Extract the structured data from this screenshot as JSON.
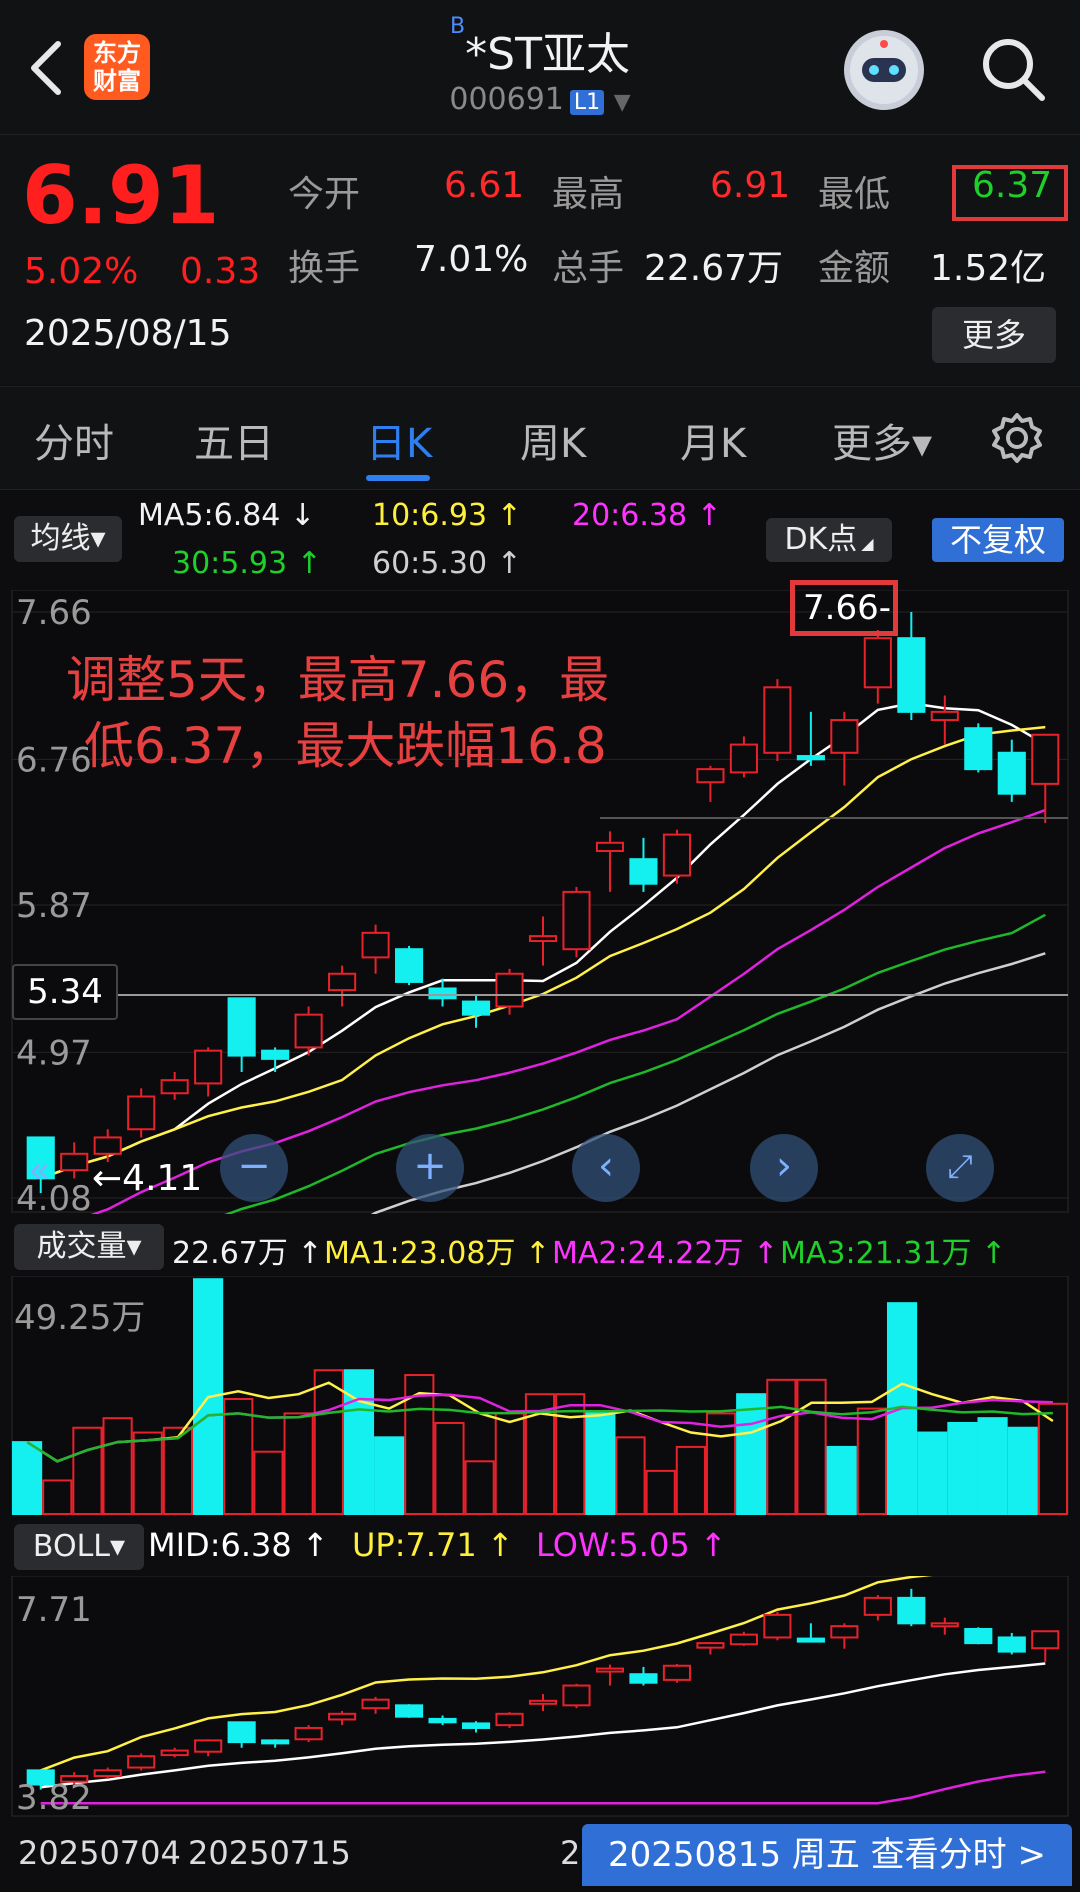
{
  "header": {
    "logo_text": "东方\n财富",
    "title_prefix": "B",
    "title": "*ST亚太",
    "code": "000691",
    "level_badge": "L1"
  },
  "quote": {
    "price": "6.91",
    "change_pct": "5.02%",
    "change_amt": "0.33",
    "date": "2025/08/15",
    "fields": [
      {
        "label": "今开",
        "value": "6.61",
        "color": "red"
      },
      {
        "label": "最高",
        "value": "6.91",
        "color": "red"
      },
      {
        "label": "最低",
        "value": "6.37",
        "color": "grn"
      },
      {
        "label": "换手",
        "value": "7.01%",
        "color": "wht"
      },
      {
        "label": "总手",
        "value": "22.67万",
        "color": "wht"
      },
      {
        "label": "金额",
        "value": "1.52亿",
        "color": "wht"
      }
    ],
    "more_label": "更多"
  },
  "tabs": [
    {
      "label": "分时"
    },
    {
      "label": "五日"
    },
    {
      "label": "日K",
      "active": true
    },
    {
      "label": "周K"
    },
    {
      "label": "月K"
    },
    {
      "label": "更多▾"
    }
  ],
  "ma_bar": {
    "selector": "均线▾",
    "ma5": "MA5:6.84",
    "ma10": "10:6.93",
    "ma20": "20:6.38",
    "ma30": "30:5.93",
    "ma60": "60:5.30",
    "dk_label": "DK点",
    "fq_label": "不复权"
  },
  "kline": {
    "y_labels": [
      "7.66",
      "6.76",
      "5.87",
      "4.97",
      "4.08"
    ],
    "crosshair_value": "5.34",
    "high_marker": "7.66-",
    "low_marker": "4.11",
    "annotation_line1": "调整5天，最高7.66，最",
    "annotation_line2": "低6.37，最大跌幅16.8"
  },
  "volume": {
    "selector": "成交量▾",
    "vol": "22.67万",
    "ma1": "MA1:23.08万",
    "ma2": "MA2:24.22万",
    "ma3": "MA3:21.31万",
    "y_label": "49.25万"
  },
  "boll": {
    "selector": "BOLL▾",
    "mid": "MID:6.38",
    "up": "UP:7.71",
    "low": "LOW:5.05",
    "y_top": "7.71",
    "y_bottom": "3.82"
  },
  "x_axis": {
    "labels": [
      "20250704",
      "20250715",
      "2"
    ]
  },
  "bottom_button": "20250815 周五 查看分时 >",
  "colors": {
    "up": "#e8212b",
    "down": "#14f0f0",
    "ma5": "#ffffff",
    "ma10": "#fff04a",
    "ma20": "#e022e0",
    "ma30": "#1fb82a",
    "ma60": "#cfcfcf",
    "accent": "#2f7ff0"
  },
  "chart_data": {
    "type": "candlestick",
    "dates_shown": [
      "20250704",
      "20250715"
    ],
    "candles": [
      {
        "o": 4.45,
        "c": 4.2,
        "h": 4.45,
        "l": 4.11
      },
      {
        "o": 4.25,
        "c": 4.35,
        "h": 4.42,
        "l": 4.2
      },
      {
        "o": 4.35,
        "c": 4.45,
        "h": 4.5,
        "l": 4.3
      },
      {
        "o": 4.5,
        "c": 4.7,
        "h": 4.75,
        "l": 4.45
      },
      {
        "o": 4.72,
        "c": 4.8,
        "h": 4.85,
        "l": 4.68
      },
      {
        "o": 4.78,
        "c": 4.98,
        "h": 5.0,
        "l": 4.7
      },
      {
        "o": 5.3,
        "c": 4.95,
        "h": 5.3,
        "l": 4.85
      },
      {
        "o": 4.98,
        "c": 4.93,
        "h": 5.0,
        "l": 4.85
      },
      {
        "o": 5.0,
        "c": 5.2,
        "h": 5.25,
        "l": 4.95
      },
      {
        "o": 5.35,
        "c": 5.45,
        "h": 5.5,
        "l": 5.25
      },
      {
        "o": 5.55,
        "c": 5.7,
        "h": 5.75,
        "l": 5.45
      },
      {
        "o": 5.6,
        "c": 5.4,
        "h": 5.62,
        "l": 5.38
      },
      {
        "o": 5.36,
        "c": 5.3,
        "h": 5.42,
        "l": 5.25
      },
      {
        "o": 5.28,
        "c": 5.2,
        "h": 5.32,
        "l": 5.12
      },
      {
        "o": 5.25,
        "c": 5.45,
        "h": 5.48,
        "l": 5.2
      },
      {
        "o": 5.65,
        "c": 5.68,
        "h": 5.8,
        "l": 5.5
      },
      {
        "o": 5.6,
        "c": 5.95,
        "h": 5.98,
        "l": 5.55
      },
      {
        "o": 6.2,
        "c": 6.25,
        "h": 6.32,
        "l": 5.95
      },
      {
        "o": 6.15,
        "c": 6.0,
        "h": 6.28,
        "l": 5.95
      },
      {
        "o": 6.05,
        "c": 6.3,
        "h": 6.33,
        "l": 6.0
      },
      {
        "o": 6.62,
        "c": 6.7,
        "h": 6.72,
        "l": 6.5
      },
      {
        "o": 6.68,
        "c": 6.85,
        "h": 6.9,
        "l": 6.65
      },
      {
        "o": 6.8,
        "c": 7.2,
        "h": 7.25,
        "l": 6.75
      },
      {
        "o": 6.78,
        "c": 6.76,
        "h": 7.05,
        "l": 6.72
      },
      {
        "o": 6.8,
        "c": 7.0,
        "h": 7.05,
        "l": 6.6
      },
      {
        "o": 7.2,
        "c": 7.5,
        "h": 7.55,
        "l": 7.1
      },
      {
        "o": 7.5,
        "c": 7.05,
        "h": 7.66,
        "l": 7.0
      },
      {
        "o": 7.0,
        "c": 7.05,
        "h": 7.15,
        "l": 6.85
      },
      {
        "o": 6.95,
        "c": 6.7,
        "h": 6.98,
        "l": 6.68
      },
      {
        "o": 6.8,
        "c": 6.55,
        "h": 6.88,
        "l": 6.5
      },
      {
        "o": 6.61,
        "c": 6.91,
        "h": 6.91,
        "l": 6.37
      }
    ],
    "volume_wan": [
      15,
      7,
      18,
      20,
      17,
      18,
      49,
      24,
      13,
      21,
      30,
      30,
      16,
      29,
      19,
      11,
      21,
      25,
      25,
      21,
      16,
      9,
      14,
      21,
      25,
      28,
      28,
      14,
      22,
      44,
      17,
      19,
      20,
      18,
      23
    ],
    "ylim": [
      4.08,
      7.66
    ],
    "vol_ylim": [
      0,
      49.25
    ]
  }
}
